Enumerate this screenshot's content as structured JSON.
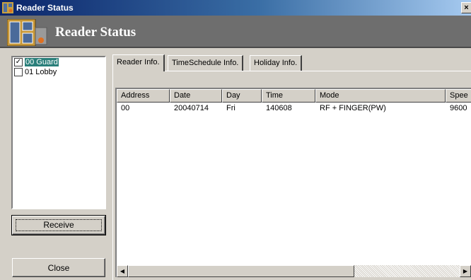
{
  "window": {
    "title": "Reader Status",
    "close_glyph": "×"
  },
  "header": {
    "title": "Reader Status",
    "icon": "reader-status-icon"
  },
  "readers": [
    {
      "label": "00 Guard",
      "checked": true,
      "selected": true
    },
    {
      "label": "01 Lobby",
      "checked": false,
      "selected": false
    }
  ],
  "buttons": {
    "receive": "Receive",
    "close": "Close"
  },
  "tabs": [
    {
      "label": "Reader Info.",
      "active": true
    },
    {
      "label": "TimeSchedule Info.",
      "active": false
    },
    {
      "label": "Holiday Info.",
      "active": false
    }
  ],
  "grid": {
    "columns": [
      "Address",
      "Date",
      "Day",
      "Time",
      "Mode",
      "Spee"
    ],
    "rows": [
      [
        "00",
        "20040714",
        "Fri",
        "140608",
        "RF + FINGER(PW)",
        "9600"
      ]
    ]
  },
  "scrollbar": {
    "left_glyph": "◀",
    "right_glyph": "▶"
  },
  "colors": {
    "selection": "#2a7f7a",
    "header_bg": "#6e6e6e",
    "title_gradient_start": "#0a246a"
  }
}
